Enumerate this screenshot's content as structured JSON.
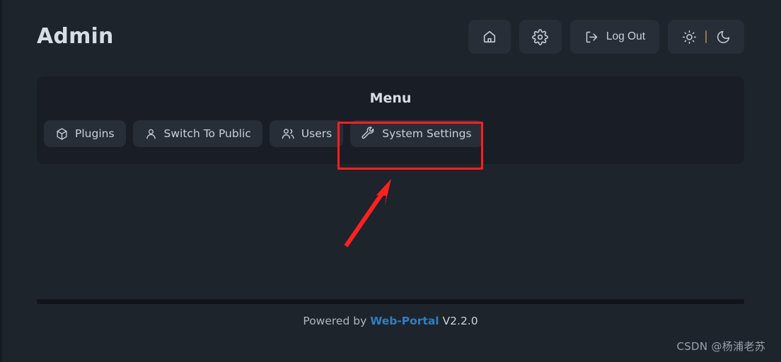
{
  "header": {
    "title": "Admin",
    "actions": [
      {
        "name": "home-button",
        "icon": "home-icon",
        "label": ""
      },
      {
        "name": "settings-button",
        "icon": "gear-icon",
        "label": ""
      },
      {
        "name": "logout-button",
        "icon": "logout-icon",
        "label": "Log Out"
      }
    ],
    "theme_toggle": {
      "light_icon": "sun-icon",
      "dark_icon": "moon-icon",
      "divider_color": "#8a7a52"
    }
  },
  "menu_panel": {
    "title": "Menu",
    "items": [
      {
        "label": "Plugins",
        "icon": "package-icon",
        "highlighted": false
      },
      {
        "label": "Switch To Public",
        "icon": "user-icon",
        "highlighted": false
      },
      {
        "label": "Users",
        "icon": "users-icon",
        "highlighted": false
      },
      {
        "label": "System Settings",
        "icon": "wrench-icon",
        "highlighted": true
      }
    ]
  },
  "annotation": {
    "highlight_color": "#fe2020",
    "arrow_color": "#fe2020",
    "target": "System Settings"
  },
  "footer": {
    "prefix": "Powered by",
    "brand": "Web-Portal",
    "version": "V2.2.0",
    "brand_color": "#2f7fc1"
  },
  "watermark": {
    "text": "CSDN @杨浦老苏"
  },
  "colors": {
    "page_bg": "#1e242c",
    "panel_bg": "#191e26",
    "button_bg": "#272e38",
    "text": "#cdd3da"
  }
}
